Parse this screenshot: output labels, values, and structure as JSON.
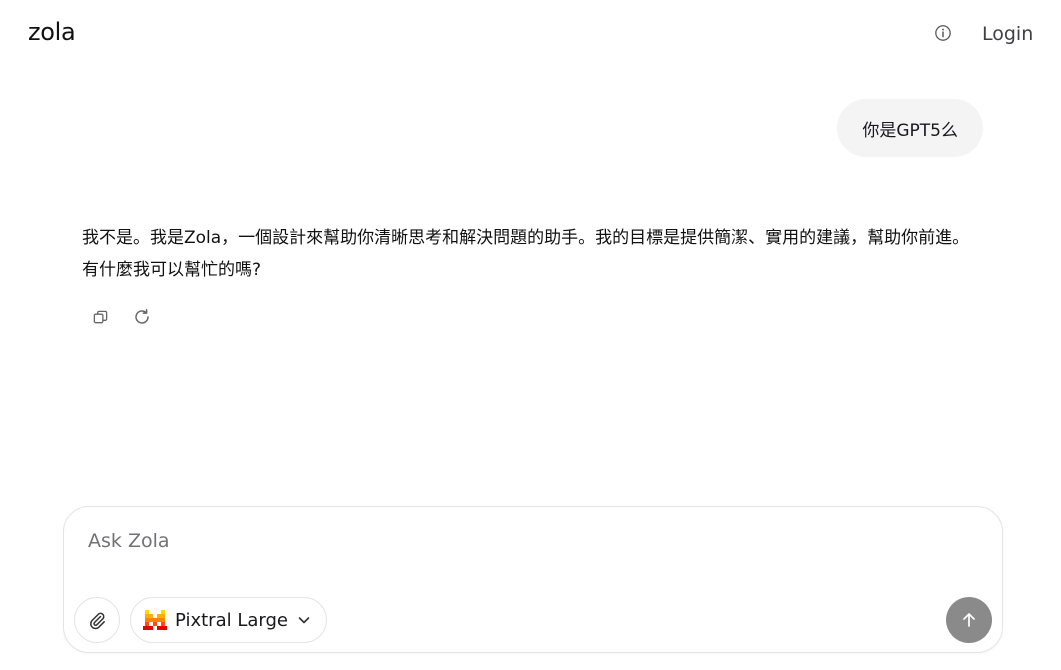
{
  "header": {
    "brand": "zola",
    "login_label": "Login",
    "info_icon": "info-icon"
  },
  "conversation": {
    "user_message": "你是GPT5么",
    "assistant_message": "我不是。我是Zola，一個設計來幫助你清晰思考和解決問題的助手。我的目標是提供簡潔、實用的建議，幫助你前進。有什麼我可以幫忙的嗎?",
    "actions": [
      {
        "name": "copy",
        "icon": "copy-icon"
      },
      {
        "name": "regenerate",
        "icon": "refresh-icon"
      }
    ]
  },
  "composer": {
    "placeholder": "Ask Zola",
    "value": "",
    "model_label": "Pixtral Large",
    "model_icon": "mistral-logo-icon",
    "attach_icon": "paperclip-icon",
    "send_icon": "arrow-up-icon"
  },
  "colors": {
    "bubble_bg": "#f4f4f5",
    "send_button_bg": "#8a8a8a",
    "border": "#e4e4e7",
    "logo_red": "#e10500",
    "logo_orange": "#fa520f",
    "logo_yellow": "#ffd800"
  }
}
